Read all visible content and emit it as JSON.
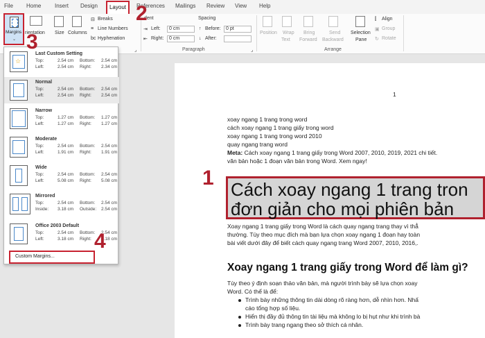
{
  "tabs": [
    "File",
    "Home",
    "Insert",
    "Design",
    "Layout",
    "References",
    "Mailings",
    "Review",
    "View",
    "Help"
  ],
  "ribbon": {
    "margins_label": "Margins",
    "orientation_label": "rientation",
    "size_label": "Size",
    "columns_label": "Columns",
    "breaks_label": "Breaks",
    "line_numbers_label": "Line Numbers",
    "hyphenation_label": "Hyphenation",
    "indent_heading": "dent",
    "indent_left_label": "Left:",
    "indent_left_value": "0 cm",
    "indent_right_label": "Right:",
    "indent_right_value": "0 cm",
    "spacing_heading": "Spacing",
    "spacing_before_label": "Before:",
    "spacing_before_value": "0 pt",
    "spacing_after_label": "After:",
    "spacing_after_value": "",
    "paragraph_group": "Paragraph",
    "position_label": "Position",
    "wrap_text_label_1": "Wrap",
    "wrap_text_label_2": "Text",
    "bring_forward_label_1": "Bring",
    "bring_forward_label_2": "Forward",
    "send_backward_label_1": "Send",
    "send_backward_label_2": "Backward",
    "selection_pane_label_1": "Selection",
    "selection_pane_label_2": "Pane",
    "align_label": "Align",
    "group_label": "Group",
    "rotate_label": "Rotate",
    "arrange_group": "Arrange"
  },
  "margins_menu": {
    "presets": [
      {
        "name": "Last Custom Setting",
        "top_label": "Top:",
        "top": "2.54 cm",
        "bottom_label": "Bottom:",
        "bottom": "2.54 cm",
        "side1_label": "Left:",
        "side1": "2.54 cm",
        "side2_label": "Right:",
        "side2": "2.34 cm"
      },
      {
        "name": "Normal",
        "top_label": "Top:",
        "top": "2.54 cm",
        "bottom_label": "Bottom:",
        "bottom": "2.54 cm",
        "side1_label": "Left:",
        "side1": "2.54 cm",
        "side2_label": "Right:",
        "side2": "2.54 cm"
      },
      {
        "name": "Narrow",
        "top_label": "Top:",
        "top": "1.27 cm",
        "bottom_label": "Bottom:",
        "bottom": "1.27 cm",
        "side1_label": "Left:",
        "side1": "1.27 cm",
        "side2_label": "Right:",
        "side2": "1.27 cm"
      },
      {
        "name": "Moderate",
        "top_label": "Top:",
        "top": "2.54 cm",
        "bottom_label": "Bottom:",
        "bottom": "2.54 cm",
        "side1_label": "Left:",
        "side1": "1.91 cm",
        "side2_label": "Right:",
        "side2": "1.91 cm"
      },
      {
        "name": "Wide",
        "top_label": "Top:",
        "top": "2.54 cm",
        "bottom_label": "Bottom:",
        "bottom": "2.54 cm",
        "side1_label": "Left:",
        "side1": "5.08 cm",
        "side2_label": "Right:",
        "side2": "5.08 cm"
      },
      {
        "name": "Mirrored",
        "top_label": "Top:",
        "top": "2.54 cm",
        "bottom_label": "Bottom:",
        "bottom": "2.54 cm",
        "side1_label": "Inside:",
        "side1": "3.18 cm",
        "side2_label": "Outside:",
        "side2": "2.54 cm"
      },
      {
        "name": "Office 2003 Default",
        "top_label": "Top:",
        "top": "2.54 cm",
        "bottom_label": "Bottom:",
        "bottom": "2.54 cm",
        "side1_label": "Left:",
        "side1": "3.18 cm",
        "side2_label": "Right:",
        "side2": "3.18 cm"
      }
    ],
    "custom_margins": "Custom Margins..."
  },
  "document": {
    "page_number": "1",
    "lines": [
      "xoay ngang 1 trang trong word",
      "cách xoay ngang 1 trang giấy trong word",
      "xoay ngang 1 trang trong word 2010",
      "quay ngang trang word"
    ],
    "meta_label": "Meta:",
    "meta_text": " Cách xoay ngang 1 trang giấy trong Word 2007, 2010, 2019, 2021 chi tiết.",
    "meta_text_2": "văn bản hoặc 1 đoạn văn bản trong Word. Xem ngay!",
    "title_line_1": "Cách xoay ngang 1 trang tron",
    "title_line_2": "đơn giản cho mọi phiên bản",
    "intro": [
      "Xoay ngang 1 trang giấy trong Word là cách quay ngang trang thay vì thẳ",
      "thường. Tùy theo mục đích mà bạn lựa chọn xoay ngang 1 đoạn hay toàn",
      "bài viết dưới đây để biết cách quay ngang trang Word 2007, 2010, 2016,."
    ],
    "h2": "Xoay ngang 1 trang giấy trong Word để làm gì?",
    "para": [
      "Tùy theo ý định soạn thảo văn bản, mà người trình bày sẽ lựa chọn xoay",
      "Word. Có thể là để:"
    ],
    "bullets": [
      "Trình bày những thông tin dài dòng rõ ràng hơn, dễ nhìn hơn. Nhấ",
      "cáo tổng hợp số liệu.",
      "Hiển thị đầy đủ thông tin tài liệu mà không lo bị hụt như khi trình bà",
      "Trình bày trang ngang theo sở thích cá nhân."
    ]
  },
  "annotations": [
    "1",
    "2",
    "3",
    "4"
  ],
  "accent_color": "#c7212f"
}
